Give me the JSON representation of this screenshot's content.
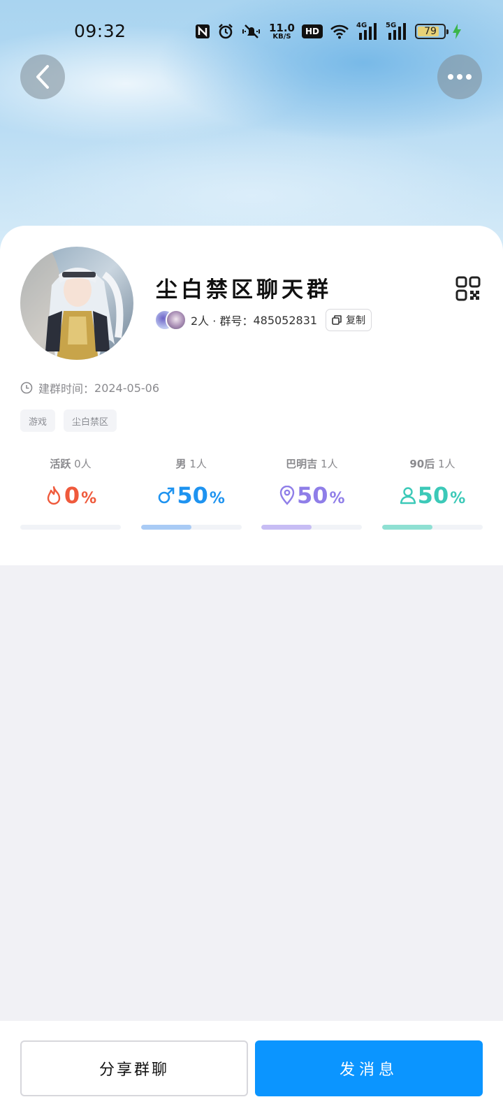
{
  "status_bar": {
    "time": "09:32",
    "net_speed": "11.0",
    "net_unit": "KB/S",
    "hd_label": "HD",
    "signal1_label": "4G",
    "signal2_label": "5G",
    "battery": "79",
    "icons": [
      "nfc-icon",
      "alarm-icon",
      "mute-icon",
      "wifi-icon",
      "charging-icon"
    ]
  },
  "nav": {
    "back_icon": "chevron-left-icon",
    "more_icon": "more-dots-icon"
  },
  "group": {
    "name": "尘白禁区聊天群",
    "members_text": "2人 · 群号：",
    "group_id": "485052831",
    "copy_label": "复制",
    "created_label": "建群时间：",
    "created_date": "2024-05-06",
    "tags": [
      "游戏",
      "尘白禁区"
    ]
  },
  "stats": [
    {
      "label": "活跃",
      "count": "0人",
      "value": "0",
      "unit": "%",
      "percent": 0,
      "color": "#ef5a3c",
      "icon": "flame-icon"
    },
    {
      "label": "男",
      "count": "1人",
      "value": "50",
      "unit": "%",
      "percent": 50,
      "color": "#1e93f0",
      "icon": "male-icon"
    },
    {
      "label": "巴明吉",
      "count": "1人",
      "value": "50",
      "unit": "%",
      "percent": 50,
      "color": "#8f7ee8",
      "icon": "location-pin-icon"
    },
    {
      "label": "90后",
      "count": "1人",
      "value": "50",
      "unit": "%",
      "percent": 50,
      "color": "#3cc9b8",
      "icon": "person-icon"
    }
  ],
  "bar_colors": [
    "#a9cbf5",
    "#a9cbf5",
    "#c7bdf4",
    "#8fe0d3"
  ],
  "bottom": {
    "share_label": "分享群聊",
    "send_label": "发消息"
  }
}
